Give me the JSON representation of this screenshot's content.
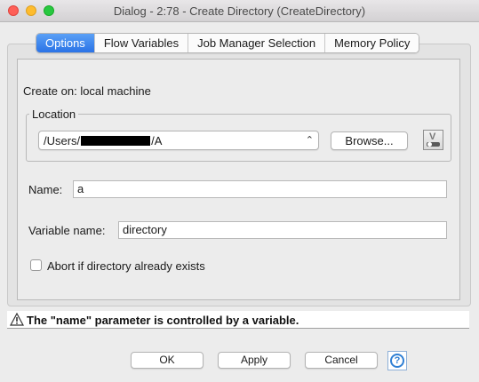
{
  "window": {
    "title": "Dialog - 2:78 - Create Directory (CreateDirectory)"
  },
  "tabs": [
    {
      "label": "Options",
      "active": true
    },
    {
      "label": "Flow Variables",
      "active": false
    },
    {
      "label": "Job Manager Selection",
      "active": false
    },
    {
      "label": "Memory Policy",
      "active": false
    }
  ],
  "options": {
    "create_on": "Create on: local machine",
    "location": {
      "legend": "Location",
      "path_prefix": "/Users/",
      "path_suffix": "/A",
      "browse_label": "Browse..."
    },
    "name_label": "Name:",
    "name_value": "a",
    "variable_label": "Variable name:",
    "variable_value": "directory",
    "abort_label": "Abort if directory already exists",
    "abort_checked": false
  },
  "warning": {
    "text": "The \"name\" parameter is controlled by a variable."
  },
  "buttons": {
    "ok": "OK",
    "apply": "Apply",
    "cancel": "Cancel"
  },
  "colors": {
    "active_tab": "#2a73e6",
    "help_icon": "#2f7fd4"
  }
}
